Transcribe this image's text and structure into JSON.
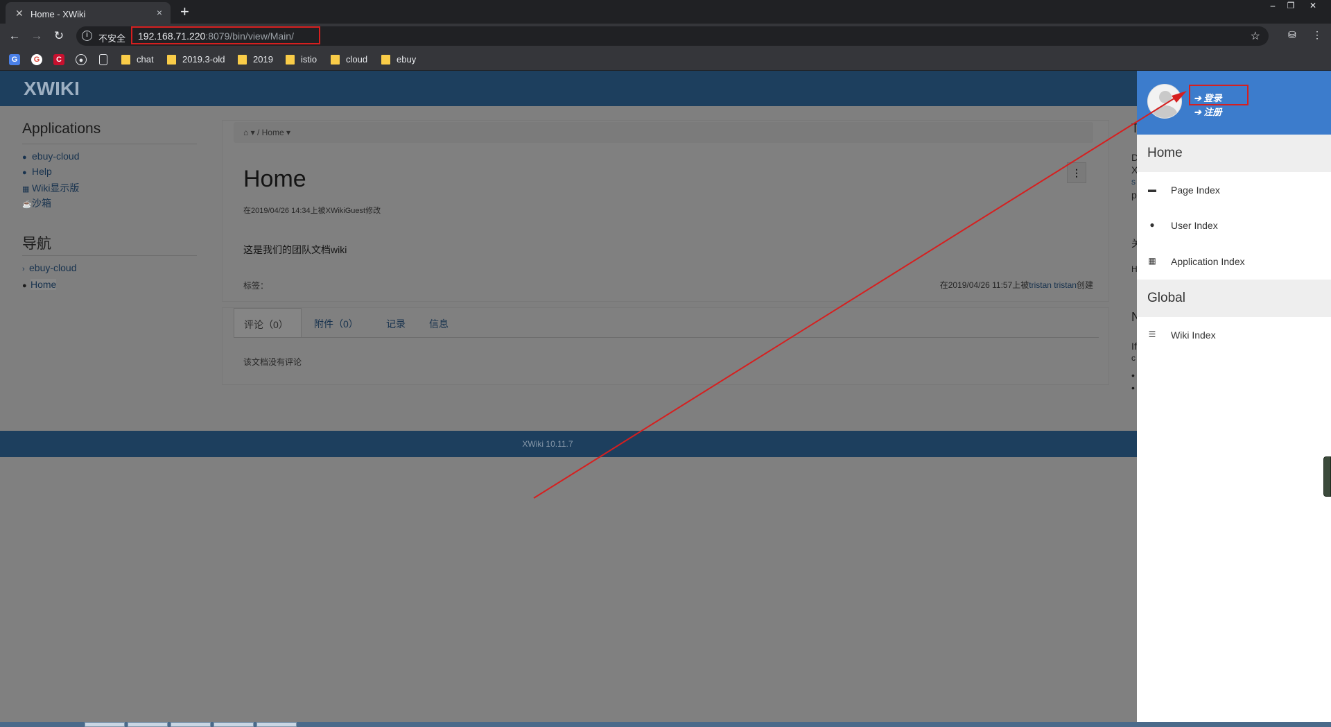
{
  "browser": {
    "tab_title": "Home - XWiki",
    "tab_close": "×",
    "new_tab": "+",
    "window_controls": [
      "–",
      "❐",
      "✕"
    ],
    "security_label": "不安全",
    "url_host": "192.168.71.220",
    "url_rest": ":8079/bin/view/Main/",
    "bookmarks": [
      "chat",
      "2019.3-old",
      "2019",
      "istio",
      "cloud",
      "ebuy"
    ]
  },
  "xwiki": {
    "logo": "XWIKI",
    "sidebar": {
      "applications_title": "Applications",
      "applications": [
        "ebuy-cloud",
        "Help",
        "Wiki显示版",
        "沙箱"
      ],
      "navigation_title": "导航",
      "navigation": [
        "ebuy-cloud",
        "Home"
      ]
    },
    "breadcrumb": "Home",
    "page_title": "Home",
    "modified": "在2019/04/26 14:34上被XWikiGuest修改",
    "content": "这是我们的团队文档wiki",
    "tags_label": "标签：",
    "created_prefix": "在2019/04/26 11:57上被",
    "created_user": "tristan tristan",
    "created_suffix": "创建",
    "doc_tabs": [
      "评论（0）",
      "附件（0）",
      "记录",
      "信息"
    ],
    "no_comments": "该文档没有评论",
    "footer": "XWiki 10.11.7",
    "right_clipped": [
      "T",
      "D",
      "X",
      "s",
      "p",
      "关",
      "H",
      "N",
      "If",
      "c",
      "•",
      "•"
    ]
  },
  "drawer": {
    "login": "登录",
    "register": "注册",
    "home_section": "Home",
    "home_items": [
      "Page Index",
      "User Index",
      "Application Index"
    ],
    "global_section": "Global",
    "global_items": [
      "Wiki Index"
    ]
  },
  "icons": {
    "tab_favicon": "xwiki-icon",
    "back": "arrow-left-icon",
    "forward": "arrow-right-icon",
    "reload": "reload-icon",
    "info": "info-icon",
    "star": "star-icon",
    "bookmark_folder": "folder-icon"
  },
  "colors": {
    "xwiki_header": "#1d3f5e",
    "drawer_header": "#3c7ccc",
    "annotation_red": "#d61f1f",
    "overlay_gray": "#808080"
  }
}
